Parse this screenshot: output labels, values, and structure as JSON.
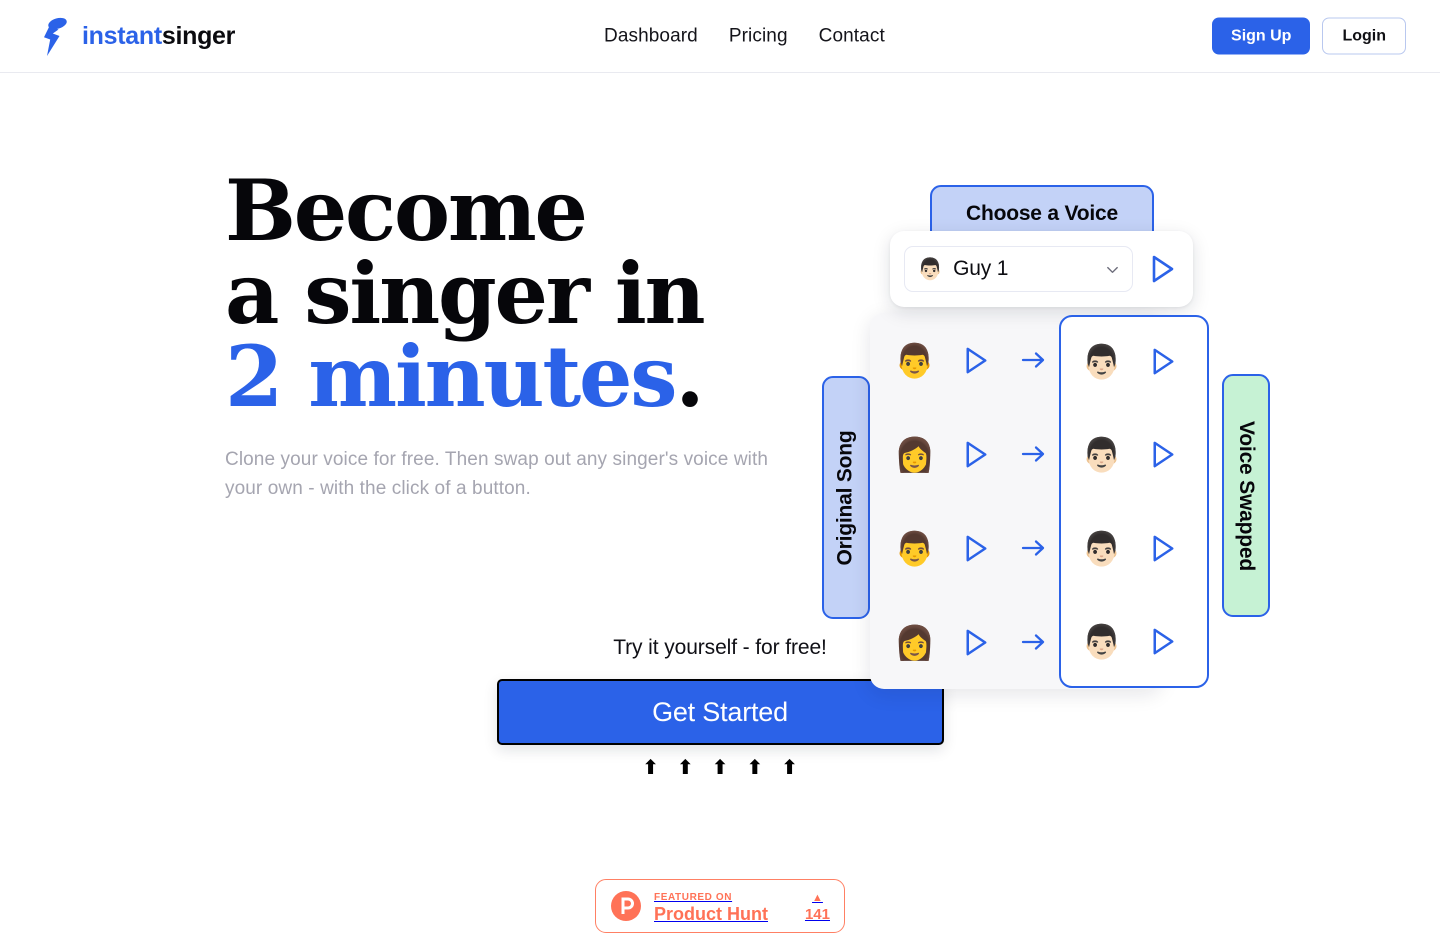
{
  "brand": {
    "icon": "microphone-bolt-icon",
    "name_prefix": "instant",
    "name_suffix": "singer"
  },
  "nav": {
    "items": [
      {
        "label": "Dashboard"
      },
      {
        "label": "Pricing"
      },
      {
        "label": "Contact"
      }
    ],
    "signup_label": "Sign Up",
    "login_label": "Login"
  },
  "hero": {
    "headline_line1": "Become",
    "headline_line2": "a singer in",
    "headline_accent": "2 minutes",
    "headline_dot": ".",
    "subhead": "Clone your voice for free. Then swap out any singer's voice with your own - with the click of a button."
  },
  "widget": {
    "choose_label": "Choose a Voice",
    "original_label": "Original Song",
    "swapped_label": "Voice Swapped",
    "selected_voice": "Guy 1",
    "selected_voice_avatar": "👨🏻",
    "chevron_icon": "chevron-down-icon",
    "preview_play_icon": "play-icon",
    "rows": [
      {
        "original_emoji": "👨",
        "swapped_emoji": "👨🏻"
      },
      {
        "original_emoji": "👩",
        "swapped_emoji": "👨🏻"
      },
      {
        "original_emoji": "👨",
        "swapped_emoji": "👨🏻"
      },
      {
        "original_emoji": "👩",
        "swapped_emoji": "👨🏻"
      }
    ]
  },
  "cta": {
    "kicker": "Try it yourself - for free!",
    "button_label": "Get Started",
    "arrows": [
      "⬆",
      "⬆",
      "⬆",
      "⬆",
      "⬆"
    ]
  },
  "product_hunt": {
    "featured_label": "FEATURED ON",
    "product_name": "Product Hunt",
    "caret": "▲",
    "count": "141"
  },
  "colors": {
    "accent_blue": "#2b62e8",
    "tag_blue_bg": "#c3d2f7",
    "tag_green_bg": "#c6f2d4",
    "panel_grey": "#f7f7f9",
    "muted_text": "#a5a5b0",
    "product_hunt_orange": "#ff7257"
  }
}
